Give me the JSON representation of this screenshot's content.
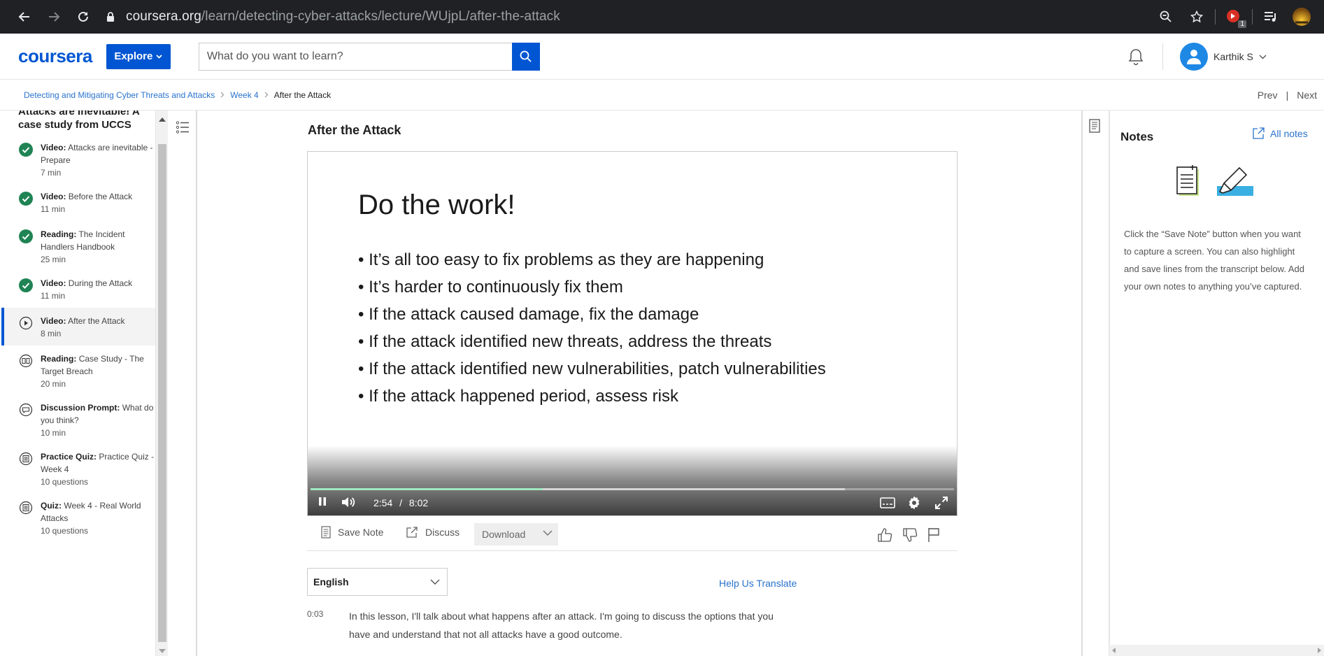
{
  "browser": {
    "url_host": "coursera.org",
    "url_path": "/learn/detecting-cyber-attacks/lecture/WUjpL/after-the-attack",
    "extension_badge": "1"
  },
  "header": {
    "logo": "coursera",
    "explore_label": "Explore",
    "search_placeholder": "What do you want to learn?",
    "user_name": "Karthik S"
  },
  "breadcrumb": {
    "course": "Detecting and Mitigating Cyber Threats and Attacks",
    "week": "Week 4",
    "current": "After the Attack",
    "prev": "Prev",
    "divider": "|",
    "next": "Next"
  },
  "sidebar": {
    "module_title": "Attacks are Inevitable! A case study from UCCS",
    "items": [
      {
        "type": "Video:",
        "title": "Attacks are inevitable - Prepare",
        "duration": "7 min",
        "status": "completed",
        "icon": "check-icon"
      },
      {
        "type": "Video:",
        "title": "Before the Attack",
        "duration": "11 min",
        "status": "completed",
        "icon": "check-icon"
      },
      {
        "type": "Reading:",
        "title": "The Incident Handlers Handbook",
        "duration": "25 min",
        "status": "completed",
        "icon": "check-icon"
      },
      {
        "type": "Video:",
        "title": "During the Attack",
        "duration": "11 min",
        "status": "completed",
        "icon": "check-icon"
      },
      {
        "type": "Video:",
        "title": "After the Attack",
        "duration": "8 min",
        "status": "active",
        "icon": "play-icon"
      },
      {
        "type": "Reading:",
        "title": "Case Study - The Target Breach",
        "duration": "20 min",
        "status": "todo",
        "icon": "book-icon"
      },
      {
        "type": "Discussion Prompt:",
        "title": "What do you think?",
        "duration": "10 min",
        "status": "todo",
        "icon": "chat-icon"
      },
      {
        "type": "Practice Quiz:",
        "title": "Practice Quiz - Week 4",
        "duration": "10 questions",
        "status": "todo",
        "icon": "quiz-icon"
      },
      {
        "type": "Quiz:",
        "title": "Week 4 - Real World Attacks",
        "duration": "10 questions",
        "status": "todo",
        "icon": "quiz-icon"
      }
    ]
  },
  "lecture": {
    "title": "After the Attack",
    "slide": {
      "title": "Do the work!",
      "bullets": [
        "It’s all too easy to fix problems as they are happening",
        "It’s harder to continuously fix them",
        "If the attack caused damage, fix the damage",
        "If the attack identified  new threats, address the threats",
        "If the attack identified  new vulnerabilities,  patch vulnerabilities",
        "If the attack happened period,  assess risk"
      ]
    },
    "player": {
      "current_time": "2:54",
      "separator": "/",
      "total_time": "8:02",
      "progress_fraction": 0.361,
      "buffered_fraction": 0.83
    }
  },
  "actions": {
    "save_note": "Save Note",
    "discuss": "Discuss",
    "download": "Download"
  },
  "transcript": {
    "language": "English",
    "help_translate": "Help Us Translate",
    "lines": [
      {
        "time": "0:03",
        "text": "In this lesson, I'll talk about what happens after an attack. I'm going to discuss the options that you have and understand that not all attacks have a good outcome."
      }
    ]
  },
  "notes": {
    "title": "Notes",
    "all_notes": "All notes",
    "message": "Click the “Save Note” button when you want to capture a screen. You can also highlight and save lines from the transcript below. Add your own notes to anything you’ve captured."
  },
  "colors": {
    "brand": "#0056d2",
    "link": "#2a73cc",
    "complete": "#1f8354",
    "progress": "#2ecc71"
  }
}
